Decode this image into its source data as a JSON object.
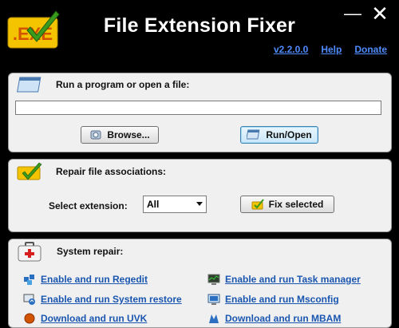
{
  "header": {
    "title": "File Extension Fixer",
    "logo_text": ".EXE",
    "min_glyph": "—",
    "close_glyph": "✕",
    "links": [
      "v2.2.0.0",
      "Help",
      "Donate"
    ]
  },
  "run_panel": {
    "label": "Run a program or open a file:",
    "input_value": "",
    "browse_label": "Browse...",
    "run_label": "Run/Open"
  },
  "repair_panel": {
    "label": "Repair file associations:",
    "select_label": "Select extension:",
    "select_value": "All",
    "fix_label": "Fix selected"
  },
  "system_panel": {
    "label": "System repair:",
    "links": [
      "Enable and run Regedit",
      "Enable and run Task manager",
      "Enable and run System restore",
      "Enable and run Msconfig",
      "Download and run UVK",
      "Download and run MBAM"
    ]
  },
  "colors": {
    "accent": "#4f8cff",
    "link": "#1a56b0",
    "logo_yellow": "#f5c400",
    "check_green": "#3a9a1e"
  }
}
